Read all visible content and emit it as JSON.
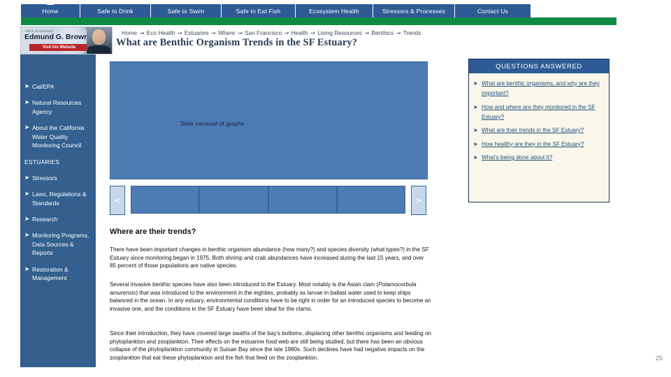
{
  "topnav": {
    "tabs": [
      {
        "label": "Home"
      },
      {
        "label": "Safe to Drink"
      },
      {
        "label": "Safe to Swim"
      },
      {
        "label": "Safe to Eat Fish"
      },
      {
        "label": "Ecosystem Health"
      },
      {
        "label": "Stressors & Processes"
      },
      {
        "label": "Contact Us"
      }
    ]
  },
  "banner": {
    "office": "Office of Governor",
    "name": "Edmund G. Brown Jr.",
    "button": "Visit his Website"
  },
  "breadcrumb": {
    "items": [
      "Home",
      "Eco Health",
      "Estuaries",
      "Where",
      "San Francisco",
      "Health",
      "Living Resources",
      "Benthics",
      "Trends"
    ],
    "separator": "→"
  },
  "page": {
    "title": "What are Benthic Organism Trends in the SF Estuary?",
    "number": "25"
  },
  "sidebar": {
    "items": [
      {
        "label": "Cal/EPA",
        "bullet": "➤"
      },
      {
        "label": "Natural Resources Agency",
        "bullet": "➤"
      },
      {
        "label": "About the California Water Quality Monitoring Council",
        "bullet": "➤"
      }
    ],
    "section_heading": "ESTUARIES",
    "section_items": [
      {
        "label": "Stressors",
        "bullet": "➤"
      },
      {
        "label": "Laws, Regulations & Standards",
        "bullet": "➤"
      },
      {
        "label": "Research",
        "bullet": "➤"
      },
      {
        "label": "Monitoring Programs, Data Sources & Reports",
        "bullet": "➤"
      },
      {
        "label": "Restoration & Management",
        "bullet": "➤"
      }
    ]
  },
  "questions": {
    "heading": "QUESTIONS ANSWERED",
    "bullet": "➤",
    "items": [
      "What are benthic organisms, and why are they important?",
      "How and where are they monitored in the SF Estuary?",
      "What are their trends in the SF Estuary?",
      "How healthy are they in the SF Estuary?",
      "What's being done about it?"
    ]
  },
  "carousel": {
    "placeholder_label": "Slide carousel of graphs",
    "prev_label": "<",
    "next_label": ">",
    "thumb_count": 4
  },
  "content": {
    "section_heading": "Where are their trends?",
    "paragraph1": "There have been important changes in benthic organism abundance (how many?) and species diversity (what types?) in the SF Estuary since monitoring began in 1975. Both shrimp and crab abundances have increased during the last 15 years, and over 85 percent of those populations are native species.",
    "paragraph2_a": "Several invasive benthic species have also been introduced to the Estuary. Most notably is the Asian clam (",
    "paragraph2_italic": "Potamocorbula amurensis",
    "paragraph2_b": ") that was introduced to the environment in the eighties, probably as larvae in ballast water used to keep ships balanced in the ocean. In any estuary, environmental conditions have to be right in order for an introduced species to become an invasive one, and the conditions in the SF Estuary have been ideal for the clams.",
    "paragraph3": "Since their introduction, they have covered large swaths of the bay's bottoms, displacing other benthic organisms and feeding on phytoplankton and zooplankton. Their effects on the estuarine food web are still being studied, but there has been an obvious collapse of the phytoplankton community in Suisan Bay since the late 1980s. Such declines have had negative impacts on the zooplankton that eat these phytoplankton and the fish that feed on the zooplankton."
  },
  "colors": {
    "nav_blue": "#2e5b95",
    "green_bar": "#0f8a43",
    "sidebar_blue": "#33608f",
    "carousel_blue": "#4d7cb5",
    "question_panel_bg": "#faf6e9",
    "link_blue": "#1f4e79",
    "banner_red": "#b8252b"
  }
}
